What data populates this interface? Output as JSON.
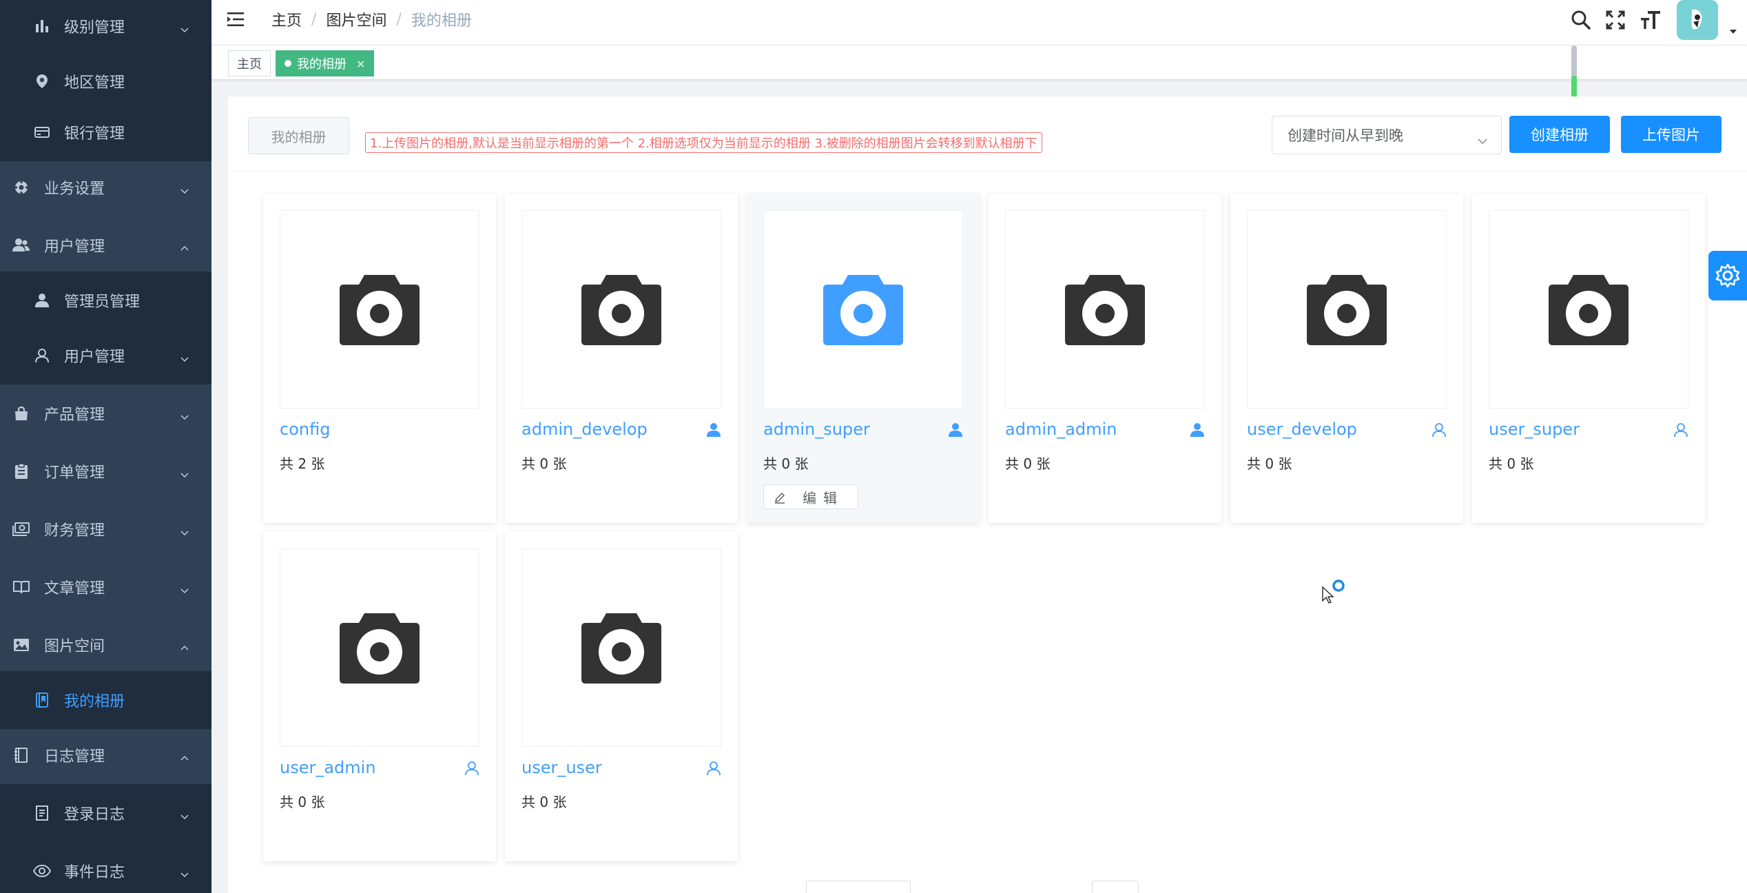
{
  "sidebar": {
    "items": [
      {
        "label": "级别管理",
        "icon": "bar-chart-icon",
        "level": "sub",
        "arrow": "down"
      },
      {
        "label": "地区管理",
        "icon": "location-pin-icon",
        "level": "sub",
        "arrow": ""
      },
      {
        "label": "银行管理",
        "icon": "credit-card-icon",
        "level": "sub",
        "arrow": ""
      },
      {
        "label": "业务设置",
        "icon": "gear-icon",
        "level": "top",
        "arrow": "down"
      },
      {
        "label": "用户管理",
        "icon": "users-icon",
        "level": "top",
        "arrow": "up"
      },
      {
        "label": "管理员管理",
        "icon": "user-solid-icon",
        "level": "sub",
        "arrow": ""
      },
      {
        "label": "用户管理",
        "icon": "user-outline-icon",
        "level": "sub",
        "arrow": "down"
      },
      {
        "label": "产品管理",
        "icon": "shopping-bag-icon",
        "level": "top",
        "arrow": "down"
      },
      {
        "label": "订单管理",
        "icon": "clipboard-icon",
        "level": "top",
        "arrow": "down"
      },
      {
        "label": "财务管理",
        "icon": "money-icon",
        "level": "top",
        "arrow": "down"
      },
      {
        "label": "文章管理",
        "icon": "book-icon",
        "level": "top",
        "arrow": "down"
      },
      {
        "label": "图片空间",
        "icon": "image-icon",
        "level": "top",
        "arrow": "up"
      },
      {
        "label": "我的相册",
        "icon": "album-icon",
        "level": "sub",
        "arrow": "",
        "active": true
      },
      {
        "label": "日志管理",
        "icon": "log-book-icon",
        "level": "top",
        "arrow": "up"
      },
      {
        "label": "登录日志",
        "icon": "document-icon",
        "level": "sub",
        "arrow": "down"
      },
      {
        "label": "事件日志",
        "icon": "eye-icon",
        "level": "sub",
        "arrow": "down"
      }
    ]
  },
  "navbar": {
    "breadcrumb": [
      "主页",
      "图片空间",
      "我的相册"
    ]
  },
  "tags": {
    "home": "主页",
    "active": "我的相册",
    "close": "×"
  },
  "toolbar": {
    "my_album_button": "我的相册",
    "tip": "1.上传图片的相册,默认是当前显示相册的第一个 2.相册选项仅为当前显示的相册 3.被删除的相册图片会转移到默认相册下",
    "sort_value": "创建时间从早到晚",
    "create_album": "创建相册",
    "upload_image": "上传图片"
  },
  "albums": [
    {
      "name": "config",
      "count": "共 2 张",
      "user_icon": "",
      "highlight": false
    },
    {
      "name": "admin_develop",
      "count": "共 0 张",
      "user_icon": "solid",
      "highlight": false
    },
    {
      "name": "admin_super",
      "count": "共 0 张",
      "user_icon": "solid",
      "highlight": true,
      "edit": "编辑"
    },
    {
      "name": "admin_admin",
      "count": "共 0 张",
      "user_icon": "solid",
      "highlight": false
    },
    {
      "name": "user_develop",
      "count": "共 0 张",
      "user_icon": "outline",
      "highlight": false
    },
    {
      "name": "user_super",
      "count": "共 0 张",
      "user_icon": "outline",
      "highlight": false
    },
    {
      "name": "user_admin",
      "count": "共 0 张",
      "user_icon": "outline",
      "highlight": false
    },
    {
      "name": "user_user",
      "count": "共 0 张",
      "user_icon": "outline",
      "highlight": false
    }
  ],
  "colors": {
    "sidebar_bg": "#304156",
    "accent": "#409eff",
    "primary_button": "#1890ff",
    "tag_active": "#42b983",
    "warning": "#f56c6c"
  }
}
